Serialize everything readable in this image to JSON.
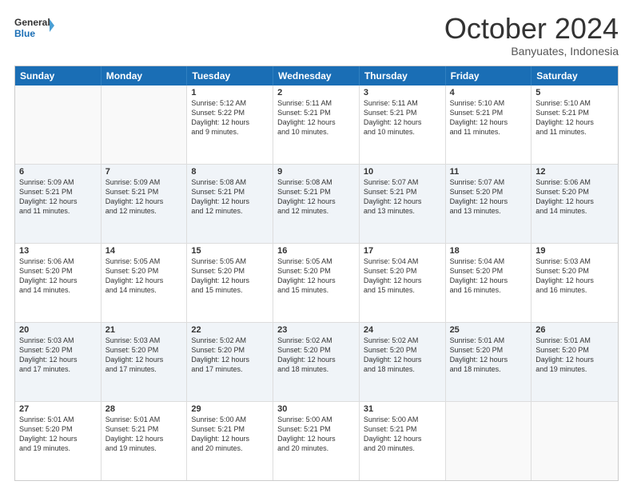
{
  "header": {
    "logo_general": "General",
    "logo_blue": "Blue",
    "month_title": "October 2024",
    "subtitle": "Banyuates, Indonesia"
  },
  "weekdays": [
    "Sunday",
    "Monday",
    "Tuesday",
    "Wednesday",
    "Thursday",
    "Friday",
    "Saturday"
  ],
  "rows": [
    {
      "alt": false,
      "cells": [
        {
          "day": "",
          "lines": []
        },
        {
          "day": "",
          "lines": []
        },
        {
          "day": "1",
          "lines": [
            "Sunrise: 5:12 AM",
            "Sunset: 5:22 PM",
            "Daylight: 12 hours",
            "and 9 minutes."
          ]
        },
        {
          "day": "2",
          "lines": [
            "Sunrise: 5:11 AM",
            "Sunset: 5:21 PM",
            "Daylight: 12 hours",
            "and 10 minutes."
          ]
        },
        {
          "day": "3",
          "lines": [
            "Sunrise: 5:11 AM",
            "Sunset: 5:21 PM",
            "Daylight: 12 hours",
            "and 10 minutes."
          ]
        },
        {
          "day": "4",
          "lines": [
            "Sunrise: 5:10 AM",
            "Sunset: 5:21 PM",
            "Daylight: 12 hours",
            "and 11 minutes."
          ]
        },
        {
          "day": "5",
          "lines": [
            "Sunrise: 5:10 AM",
            "Sunset: 5:21 PM",
            "Daylight: 12 hours",
            "and 11 minutes."
          ]
        }
      ]
    },
    {
      "alt": true,
      "cells": [
        {
          "day": "6",
          "lines": [
            "Sunrise: 5:09 AM",
            "Sunset: 5:21 PM",
            "Daylight: 12 hours",
            "and 11 minutes."
          ]
        },
        {
          "day": "7",
          "lines": [
            "Sunrise: 5:09 AM",
            "Sunset: 5:21 PM",
            "Daylight: 12 hours",
            "and 12 minutes."
          ]
        },
        {
          "day": "8",
          "lines": [
            "Sunrise: 5:08 AM",
            "Sunset: 5:21 PM",
            "Daylight: 12 hours",
            "and 12 minutes."
          ]
        },
        {
          "day": "9",
          "lines": [
            "Sunrise: 5:08 AM",
            "Sunset: 5:21 PM",
            "Daylight: 12 hours",
            "and 12 minutes."
          ]
        },
        {
          "day": "10",
          "lines": [
            "Sunrise: 5:07 AM",
            "Sunset: 5:21 PM",
            "Daylight: 12 hours",
            "and 13 minutes."
          ]
        },
        {
          "day": "11",
          "lines": [
            "Sunrise: 5:07 AM",
            "Sunset: 5:20 PM",
            "Daylight: 12 hours",
            "and 13 minutes."
          ]
        },
        {
          "day": "12",
          "lines": [
            "Sunrise: 5:06 AM",
            "Sunset: 5:20 PM",
            "Daylight: 12 hours",
            "and 14 minutes."
          ]
        }
      ]
    },
    {
      "alt": false,
      "cells": [
        {
          "day": "13",
          "lines": [
            "Sunrise: 5:06 AM",
            "Sunset: 5:20 PM",
            "Daylight: 12 hours",
            "and 14 minutes."
          ]
        },
        {
          "day": "14",
          "lines": [
            "Sunrise: 5:05 AM",
            "Sunset: 5:20 PM",
            "Daylight: 12 hours",
            "and 14 minutes."
          ]
        },
        {
          "day": "15",
          "lines": [
            "Sunrise: 5:05 AM",
            "Sunset: 5:20 PM",
            "Daylight: 12 hours",
            "and 15 minutes."
          ]
        },
        {
          "day": "16",
          "lines": [
            "Sunrise: 5:05 AM",
            "Sunset: 5:20 PM",
            "Daylight: 12 hours",
            "and 15 minutes."
          ]
        },
        {
          "day": "17",
          "lines": [
            "Sunrise: 5:04 AM",
            "Sunset: 5:20 PM",
            "Daylight: 12 hours",
            "and 15 minutes."
          ]
        },
        {
          "day": "18",
          "lines": [
            "Sunrise: 5:04 AM",
            "Sunset: 5:20 PM",
            "Daylight: 12 hours",
            "and 16 minutes."
          ]
        },
        {
          "day": "19",
          "lines": [
            "Sunrise: 5:03 AM",
            "Sunset: 5:20 PM",
            "Daylight: 12 hours",
            "and 16 minutes."
          ]
        }
      ]
    },
    {
      "alt": true,
      "cells": [
        {
          "day": "20",
          "lines": [
            "Sunrise: 5:03 AM",
            "Sunset: 5:20 PM",
            "Daylight: 12 hours",
            "and 17 minutes."
          ]
        },
        {
          "day": "21",
          "lines": [
            "Sunrise: 5:03 AM",
            "Sunset: 5:20 PM",
            "Daylight: 12 hours",
            "and 17 minutes."
          ]
        },
        {
          "day": "22",
          "lines": [
            "Sunrise: 5:02 AM",
            "Sunset: 5:20 PM",
            "Daylight: 12 hours",
            "and 17 minutes."
          ]
        },
        {
          "day": "23",
          "lines": [
            "Sunrise: 5:02 AM",
            "Sunset: 5:20 PM",
            "Daylight: 12 hours",
            "and 18 minutes."
          ]
        },
        {
          "day": "24",
          "lines": [
            "Sunrise: 5:02 AM",
            "Sunset: 5:20 PM",
            "Daylight: 12 hours",
            "and 18 minutes."
          ]
        },
        {
          "day": "25",
          "lines": [
            "Sunrise: 5:01 AM",
            "Sunset: 5:20 PM",
            "Daylight: 12 hours",
            "and 18 minutes."
          ]
        },
        {
          "day": "26",
          "lines": [
            "Sunrise: 5:01 AM",
            "Sunset: 5:20 PM",
            "Daylight: 12 hours",
            "and 19 minutes."
          ]
        }
      ]
    },
    {
      "alt": false,
      "cells": [
        {
          "day": "27",
          "lines": [
            "Sunrise: 5:01 AM",
            "Sunset: 5:20 PM",
            "Daylight: 12 hours",
            "and 19 minutes."
          ]
        },
        {
          "day": "28",
          "lines": [
            "Sunrise: 5:01 AM",
            "Sunset: 5:21 PM",
            "Daylight: 12 hours",
            "and 19 minutes."
          ]
        },
        {
          "day": "29",
          "lines": [
            "Sunrise: 5:00 AM",
            "Sunset: 5:21 PM",
            "Daylight: 12 hours",
            "and 20 minutes."
          ]
        },
        {
          "day": "30",
          "lines": [
            "Sunrise: 5:00 AM",
            "Sunset: 5:21 PM",
            "Daylight: 12 hours",
            "and 20 minutes."
          ]
        },
        {
          "day": "31",
          "lines": [
            "Sunrise: 5:00 AM",
            "Sunset: 5:21 PM",
            "Daylight: 12 hours",
            "and 20 minutes."
          ]
        },
        {
          "day": "",
          "lines": []
        },
        {
          "day": "",
          "lines": []
        }
      ]
    }
  ]
}
